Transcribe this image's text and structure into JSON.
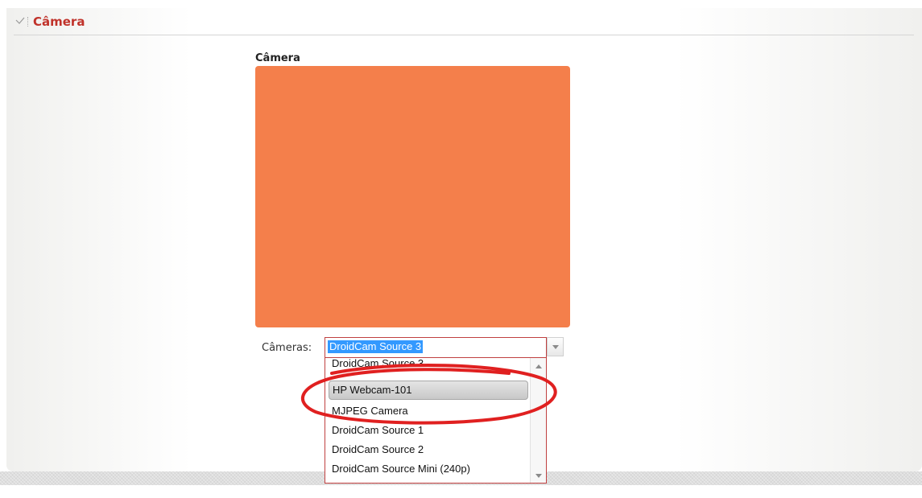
{
  "section": {
    "title": "Câmera",
    "collapse_icon": "checkmark-chevron-icon"
  },
  "preview": {
    "label": "Câmera",
    "color": "#f47f4b"
  },
  "cameras_select": {
    "label": "Câmeras:",
    "selected_value": "DroidCam Source 3",
    "arrow_icon": "chevron-down-icon"
  },
  "dropdown": {
    "options": [
      {
        "label": "DroidCam Source 3",
        "highlighted": false
      },
      {
        "label": "HP Webcam-101",
        "highlighted": true
      },
      {
        "label": "MJPEG Camera",
        "highlighted": false
      },
      {
        "label": "DroidCam Source 1",
        "highlighted": false
      },
      {
        "label": "DroidCam Source 2",
        "highlighted": false
      },
      {
        "label": "DroidCam Source Mini (240p)",
        "highlighted": false
      }
    ]
  },
  "colors": {
    "accent_red": "#c0322a",
    "selection_blue": "#3399ff",
    "annotation_red": "#e02020"
  }
}
